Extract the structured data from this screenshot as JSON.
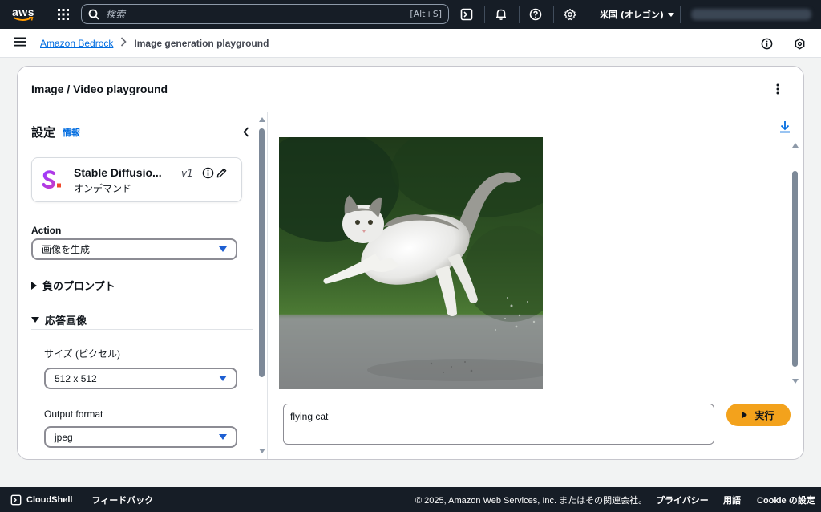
{
  "topnav": {
    "logo_text": "aws",
    "search_placeholder": "検索",
    "search_shortcut": "[Alt+S]",
    "region_label": "米国 (オレゴン)",
    "icons": [
      "grid-icon",
      "search-icon",
      "cloudshell-icon",
      "bell-icon",
      "help-icon",
      "gear-icon",
      "caret-down-icon"
    ]
  },
  "breadcrumb": {
    "parent": "Amazon Bedrock",
    "current": "Image generation playground"
  },
  "card": {
    "title": "Image / Video playground"
  },
  "settings": {
    "title": "設定",
    "info": "情報",
    "model": {
      "name": "Stable Diffusio...",
      "version": "v1",
      "subtitle": "オンデマンド"
    },
    "action_label": "Action",
    "action_value": "画像を生成",
    "negative_prompt_label": "負のプロンプト",
    "response_image_label": "応答画像",
    "size_label": "サイズ (ピクセル)",
    "size_value": "512 x 512",
    "format_label": "Output format",
    "format_value": "jpeg"
  },
  "playground": {
    "prompt_value": "flying cat",
    "run_label": "実行"
  },
  "footer": {
    "cloudshell": "CloudShell",
    "feedback": "フィードバック",
    "copyright": "© 2025, Amazon Web Services, Inc. またはその関連会社。",
    "privacy": "プライバシー",
    "terms": "用語",
    "cookie": "Cookie の設定"
  },
  "colors": {
    "nav_bg": "#161d26",
    "link": "#006ce0",
    "primary_button": "#f3a21c",
    "select_caret": "#1e5fd2"
  }
}
